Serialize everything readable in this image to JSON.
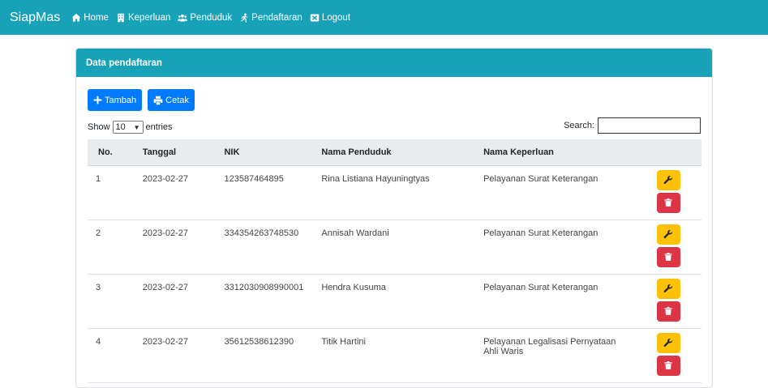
{
  "navbar": {
    "brand": "SiapMas",
    "items": [
      {
        "label": "Home",
        "icon": "home-icon"
      },
      {
        "label": "Keperluan",
        "icon": "building-icon"
      },
      {
        "label": "Penduduk",
        "icon": "users-icon"
      },
      {
        "label": "Pendaftaran",
        "icon": "running-icon"
      },
      {
        "label": "Logout",
        "icon": "logout-icon"
      }
    ]
  },
  "card": {
    "title": "Data pendaftaran",
    "buttons": {
      "add": "Tambah",
      "print": "Cetak"
    },
    "show_prefix": "Show",
    "show_value": "10",
    "show_suffix": "entries",
    "search_label": "Search:",
    "search_value": ""
  },
  "table": {
    "headers": [
      "No.",
      "Tanggal",
      "NIK",
      "Nama Penduduk",
      "Nama Keperluan",
      ""
    ],
    "rows": [
      {
        "no": "1",
        "tanggal": "2023-02-27",
        "nik": "123587464895",
        "nama": "Rina Listiana Hayuningtyas",
        "keperluan": "Pelayanan Surat Keterangan"
      },
      {
        "no": "2",
        "tanggal": "2023-02-27",
        "nik": "334354263748530",
        "nama": "Annisah Wardani",
        "keperluan": "Pelayanan Surat Keterangan"
      },
      {
        "no": "3",
        "tanggal": "2023-02-27",
        "nik": "3312030908990001",
        "nama": "Hendra Kusuma",
        "keperluan": "Pelayanan Surat Keterangan"
      },
      {
        "no": "4",
        "tanggal": "2023-02-27",
        "nik": "35612538612390",
        "nama": "Titik Hartini",
        "keperluan": "Pelayanan Legalisasi Pernyataan Ahli Waris"
      }
    ]
  },
  "colors": {
    "primary": "#17a2b8",
    "button": "#007bff",
    "edit": "#ffc107",
    "delete": "#dc3545"
  }
}
